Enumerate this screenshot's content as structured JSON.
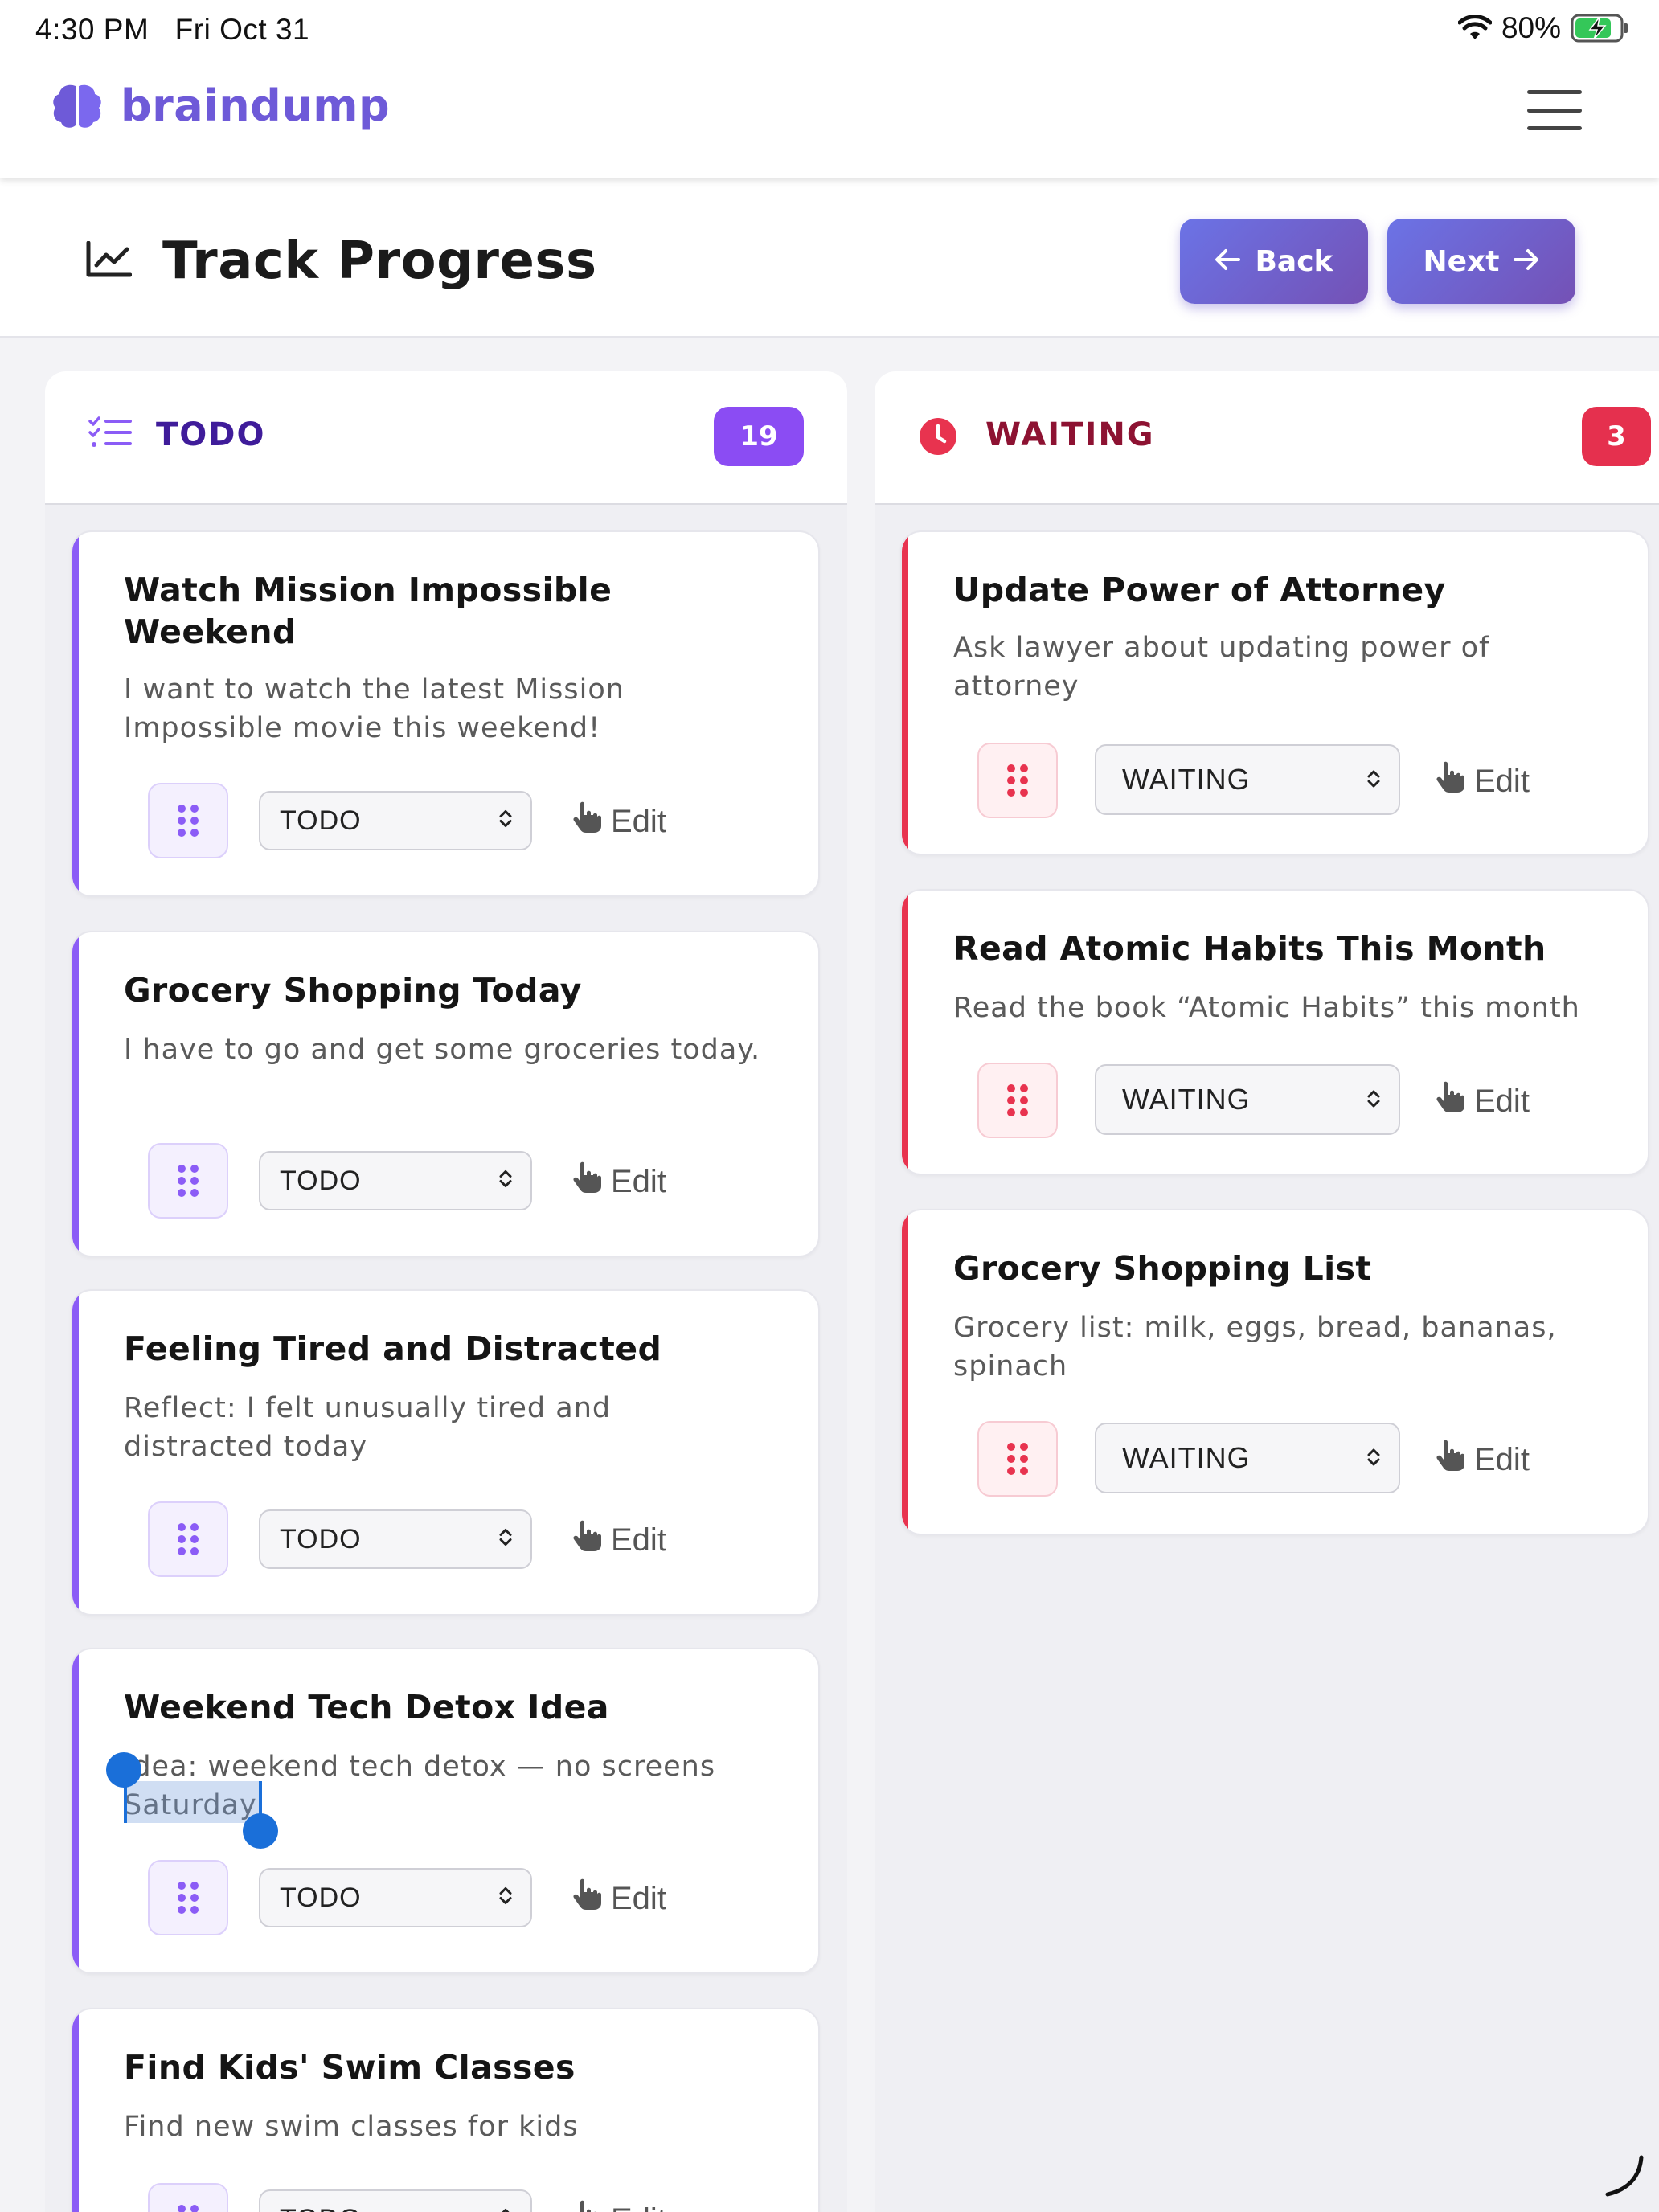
{
  "status_bar": {
    "time": "4:30 PM",
    "date": "Fri Oct 31",
    "battery": "80%"
  },
  "brand": {
    "name": "braindump",
    "icon": "brain-icon"
  },
  "header": {
    "title": "Track Progress",
    "icon": "chart-line-icon",
    "back_label": "Back",
    "next_label": "Next"
  },
  "columns": {
    "todo": {
      "title": "TODO",
      "count": "19",
      "icon": "checklist-icon",
      "accent": "#8b5cf6",
      "cards": [
        {
          "title": "Watch Mission Impossible Weekend",
          "description": "I want to watch the latest Mission Impossible movie this weekend!",
          "status": "TODO",
          "edit": "Edit"
        },
        {
          "title": "Grocery Shopping Today",
          "description": "I have to go and get some groceries today.",
          "status": "TODO",
          "edit": "Edit"
        },
        {
          "title": "Feeling Tired and Distracted",
          "description": "Reflect: I felt unusually tired and distracted today",
          "status": "TODO",
          "edit": "Edit"
        },
        {
          "title": "Weekend Tech Detox Idea",
          "description": "Idea: weekend tech detox — no screens Saturday",
          "status": "TODO",
          "edit": "Edit"
        },
        {
          "title": "Find Kids' Swim Classes",
          "description": "Find new swim classes for kids",
          "status": "TODO",
          "edit": "Edit"
        }
      ]
    },
    "waiting": {
      "title": "WAITING",
      "count": "3",
      "icon": "clock-icon",
      "accent": "#e8334f",
      "cards": [
        {
          "title": "Update Power of Attorney",
          "description": "Ask lawyer about updating power of attorney",
          "status": "WAITING",
          "edit": "Edit"
        },
        {
          "title": "Read Atomic Habits This Month",
          "description": "Read the book “Atomic Habits” this month",
          "status": "WAITING",
          "edit": "Edit"
        },
        {
          "title": "Grocery Shopping List",
          "description": "Grocery list: milk, eggs, bread, bananas, spinach",
          "status": "WAITING",
          "edit": "Edit"
        }
      ]
    }
  }
}
